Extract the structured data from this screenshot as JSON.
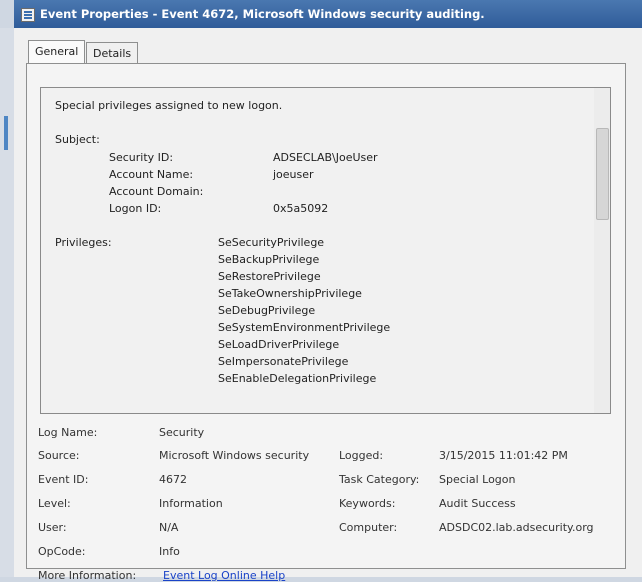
{
  "window": {
    "title": "Event Properties - Event 4672, Microsoft Windows security auditing."
  },
  "tabs": [
    {
      "label": "General"
    },
    {
      "label": "Details"
    }
  ],
  "message": {
    "description": "Special privileges assigned to new logon.",
    "subject_label": "Subject:",
    "subject_fields": [
      {
        "label": "Security ID:",
        "value": "ADSECLAB\\JoeUser"
      },
      {
        "label": "Account Name:",
        "value": "joeuser"
      },
      {
        "label": "Account Domain:",
        "value": ""
      },
      {
        "label": "Logon ID:",
        "value": "0x5a5092"
      }
    ],
    "privileges_label": "Privileges:",
    "privileges": [
      "SeSecurityPrivilege",
      "SeBackupPrivilege",
      "SeRestorePrivilege",
      "SeTakeOwnershipPrivilege",
      "SeDebugPrivilege",
      "SeSystemEnvironmentPrivilege",
      "SeLoadDriverPrivilege",
      "SeImpersonatePrivilege",
      "SeEnableDelegationPrivilege"
    ]
  },
  "fields": {
    "log_name": {
      "label": "Log Name:",
      "value": "Security"
    },
    "source": {
      "label": "Source:",
      "value": "Microsoft Windows security"
    },
    "logged": {
      "label": "Logged:",
      "value": "3/15/2015 11:01:42 PM"
    },
    "event_id": {
      "label": "Event ID:",
      "value": "4672"
    },
    "task_category": {
      "label": "Task Category:",
      "value": "Special Logon"
    },
    "level": {
      "label": "Level:",
      "value": "Information"
    },
    "keywords": {
      "label": "Keywords:",
      "value": "Audit Success"
    },
    "user": {
      "label": "User:",
      "value": "N/A"
    },
    "computer": {
      "label": "Computer:",
      "value": "ADSDC02.lab.adsecurity.org"
    },
    "opcode": {
      "label": "OpCode:",
      "value": "Info"
    },
    "more_info": {
      "label": "More Information:",
      "link": "Event Log Online Help"
    }
  }
}
